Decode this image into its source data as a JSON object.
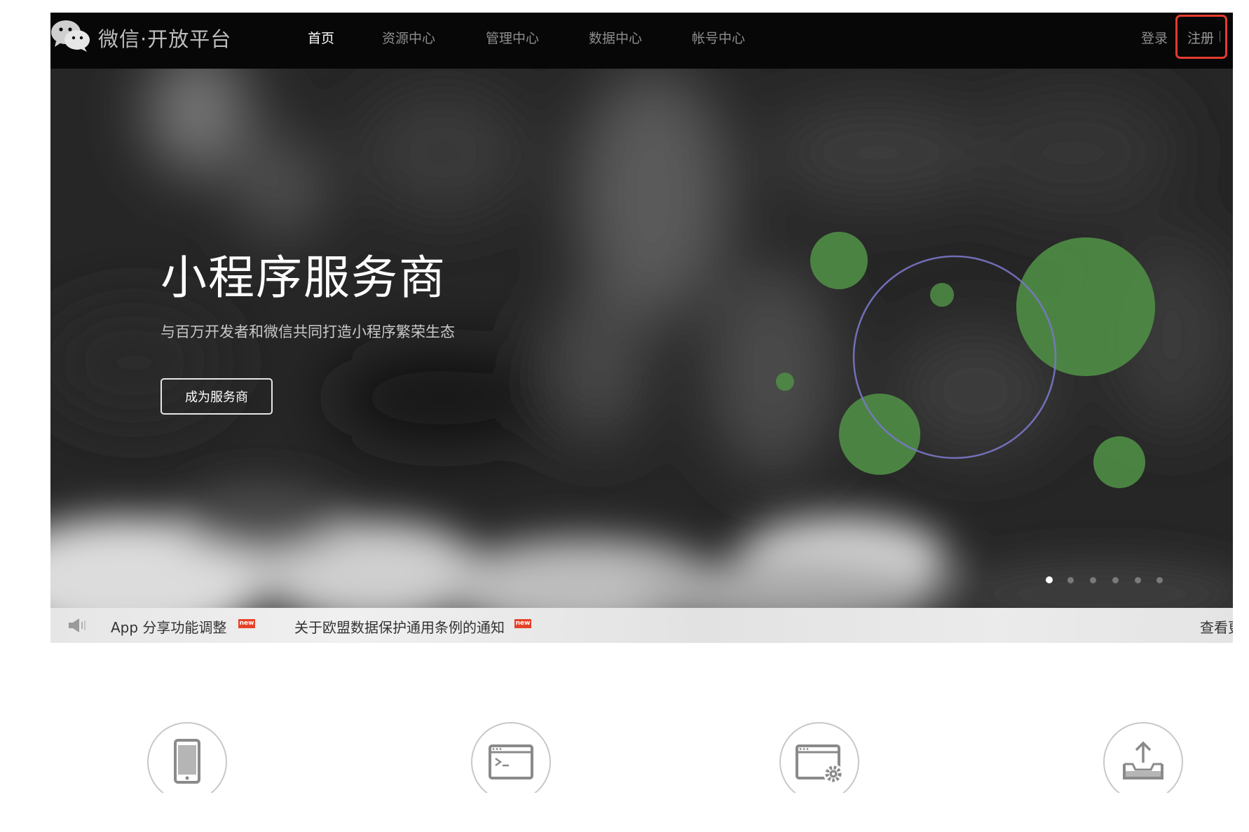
{
  "header": {
    "brand": "微信·开放平台",
    "nav": [
      {
        "label": "首页",
        "active": true
      },
      {
        "label": "资源中心",
        "active": false
      },
      {
        "label": "管理中心",
        "active": false
      },
      {
        "label": "数据中心",
        "active": false
      },
      {
        "label": "帐号中心",
        "active": false
      }
    ],
    "login_label": "登录",
    "register_label": "注册"
  },
  "hero": {
    "title": "小程序服务商",
    "subtitle": "与百万开发者和微信共同打造小程序繁荣生态",
    "cta_label": "成为服务商",
    "slides_count": 6,
    "active_slide": 1
  },
  "notice": {
    "items": [
      {
        "text": "App 分享功能调整",
        "badge": "new"
      },
      {
        "text": "关于欧盟数据保护通用条例的通知",
        "badge": "new"
      }
    ],
    "more_label": "查看更"
  },
  "features": [
    {
      "icon": "mobile-phone-icon"
    },
    {
      "icon": "terminal-window-icon"
    },
    {
      "icon": "settings-window-icon"
    },
    {
      "icon": "upload-tray-icon"
    }
  ],
  "colors": {
    "header_bg": "#070707",
    "highlight_box": "#e53b2e",
    "badge_red": "#e64228",
    "bubble_green": "#4f8e45",
    "ring_purple": "#7a77c8"
  }
}
